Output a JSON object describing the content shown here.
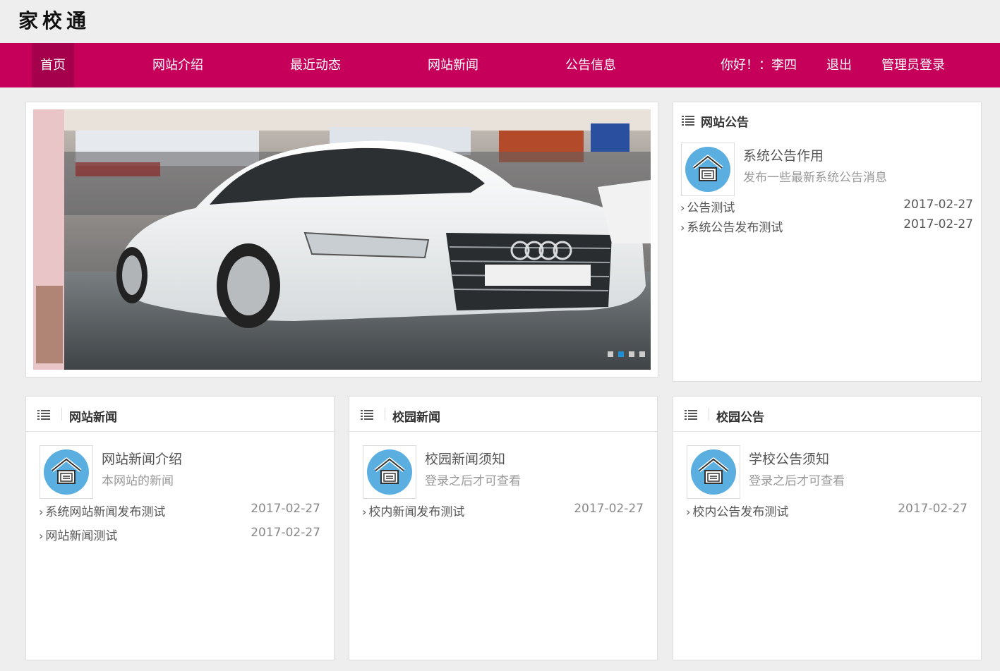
{
  "site": {
    "logo": "家校通"
  },
  "nav": {
    "items": [
      {
        "label": "首页"
      },
      {
        "label": "网站介绍"
      },
      {
        "label": "最近动态"
      },
      {
        "label": "网站新闻"
      },
      {
        "label": "公告信息"
      }
    ],
    "greeting": "你好！：李四",
    "logout": "退出",
    "admin_login": "管理员登录"
  },
  "banner": {
    "slide_count": 4,
    "active_slide": 2
  },
  "notice_panel": {
    "title": "网站公告",
    "featured": {
      "title": "系统公告作用",
      "desc": "发布一些最新系统公告消息"
    },
    "rows": [
      {
        "text": "公告测试",
        "date": "2017-02-27"
      },
      {
        "text": "系统公告发布测试",
        "date": "2017-02-27"
      }
    ]
  },
  "sections": [
    {
      "title": "网站新闻",
      "featured": {
        "title": "网站新闻介绍",
        "desc": "本网站的新闻"
      },
      "rows": [
        {
          "text": "系统网站新闻发布测试",
          "date": "2017-02-27"
        },
        {
          "text": "网站新闻测试",
          "date": "2017-02-27"
        }
      ]
    },
    {
      "title": "校园新闻",
      "featured": {
        "title": "校园新闻须知",
        "desc": "登录之后才可查看"
      },
      "rows": [
        {
          "text": "校内新闻发布测试",
          "date": "2017-02-27"
        }
      ]
    },
    {
      "title": "校园公告",
      "featured": {
        "title": "学校公告须知",
        "desc": "登录之后才可查看"
      },
      "rows": [
        {
          "text": "校内公告发布测试",
          "date": "2017-02-27"
        }
      ]
    }
  ],
  "colors": {
    "nav": "#c6005a",
    "nav_active": "#a5004b",
    "accent": "#1e8fd6",
    "icon_circle": "#5aaee0"
  },
  "icons": [
    "list-icon",
    "school-house-icon",
    "chevron-right-icon"
  ]
}
